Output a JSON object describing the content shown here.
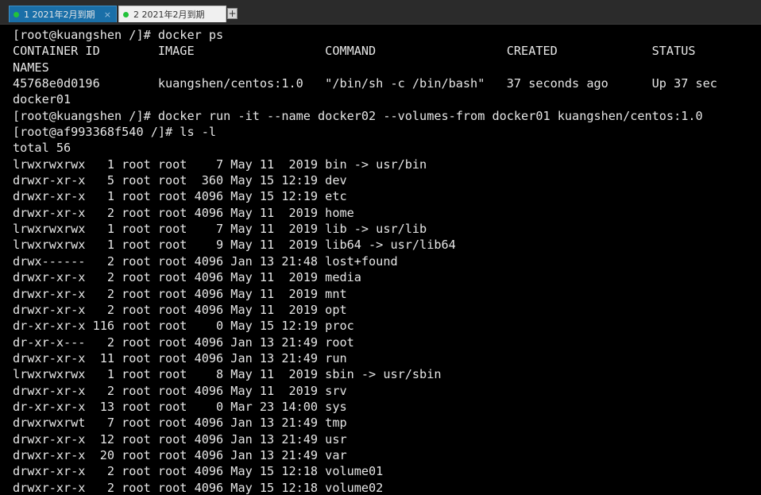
{
  "tabs": [
    {
      "label": "1 2021年2月到期",
      "close": "×",
      "status_color": "#22c23a"
    },
    {
      "label": "2 2021年2月到期",
      "status_color": "#22c23a"
    }
  ],
  "add_tab": "+",
  "terminal": {
    "lines": [
      "[root@kuangshen /]# docker ps",
      "CONTAINER ID        IMAGE                  COMMAND                  CREATED             STATUS",
      "NAMES",
      "45768e0d0196        kuangshen/centos:1.0   \"/bin/sh -c /bin/bash\"   37 seconds ago      Up 37 sec",
      "docker01",
      "[root@kuangshen /]# docker run -it --name docker02 --volumes-from docker01 kuangshen/centos:1.0",
      "[root@af993368f540 /]# ls -l",
      "total 56",
      "lrwxrwxrwx   1 root root    7 May 11  2019 bin -> usr/bin",
      "drwxr-xr-x   5 root root  360 May 15 12:19 dev",
      "drwxr-xr-x   1 root root 4096 May 15 12:19 etc",
      "drwxr-xr-x   2 root root 4096 May 11  2019 home",
      "lrwxrwxrwx   1 root root    7 May 11  2019 lib -> usr/lib",
      "lrwxrwxrwx   1 root root    9 May 11  2019 lib64 -> usr/lib64",
      "drwx------   2 root root 4096 Jan 13 21:48 lost+found",
      "drwxr-xr-x   2 root root 4096 May 11  2019 media",
      "drwxr-xr-x   2 root root 4096 May 11  2019 mnt",
      "drwxr-xr-x   2 root root 4096 May 11  2019 opt",
      "dr-xr-xr-x 116 root root    0 May 15 12:19 proc",
      "dr-xr-x---   2 root root 4096 Jan 13 21:49 root",
      "drwxr-xr-x  11 root root 4096 Jan 13 21:49 run",
      "lrwxrwxrwx   1 root root    8 May 11  2019 sbin -> usr/sbin",
      "drwxr-xr-x   2 root root 4096 May 11  2019 srv",
      "dr-xr-xr-x  13 root root    0 Mar 23 14:00 sys",
      "drwxrwxrwt   7 root root 4096 Jan 13 21:49 tmp",
      "drwxr-xr-x  12 root root 4096 Jan 13 21:49 usr",
      "drwxr-xr-x  20 root root 4096 Jan 13 21:49 var",
      "drwxr-xr-x   2 root root 4096 May 15 12:18 volume01",
      "drwxr-xr-x   2 root root 4096 May 15 12:18 volume02"
    ]
  }
}
